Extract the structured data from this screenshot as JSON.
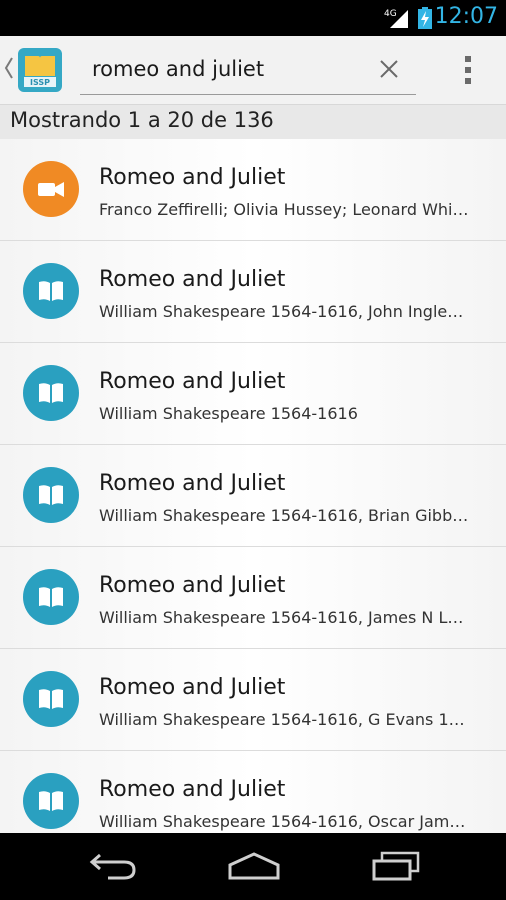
{
  "status_bar": {
    "time": "12:07",
    "network": "4G",
    "signal_icon": "signal-icon",
    "battery_icon": "battery-charging-icon",
    "accent": "#33b5e5"
  },
  "action_bar": {
    "back_icon": "back-caret-icon",
    "logo_icon": "app-logo-icon",
    "logo_text": "ISSP",
    "search": {
      "value": "romeo and juliet",
      "clear_icon": "close-icon"
    },
    "overflow_icon": "overflow-menu-icon"
  },
  "results_header": {
    "text": "Mostrando 1 a 20 de 136"
  },
  "colors": {
    "video": "#f08a24",
    "book": "#2aa0c0"
  },
  "results": [
    {
      "type": "video",
      "icon": "video-camera-icon",
      "title": "Romeo and Juliet",
      "subtitle": "Franco Zeffirelli; Olivia Hussey; Leonard Whi…"
    },
    {
      "type": "book",
      "icon": "book-icon",
      "title": "Romeo and Juliet",
      "subtitle": "William Shakespeare 1564-1616, John Ingle…"
    },
    {
      "type": "book",
      "icon": "book-icon",
      "title": "Romeo and Juliet",
      "subtitle": "William Shakespeare 1564-1616"
    },
    {
      "type": "book",
      "icon": "book-icon",
      "title": "Romeo and Juliet",
      "subtitle": "William Shakespeare 1564-1616, Brian Gibb…"
    },
    {
      "type": "book",
      "icon": "book-icon",
      "title": "Romeo and Juliet",
      "subtitle": "William Shakespeare 1564-1616, James N L…"
    },
    {
      "type": "book",
      "icon": "book-icon",
      "title": "Romeo and Juliet",
      "subtitle": "William Shakespeare 1564-1616, G Evans 1…"
    },
    {
      "type": "book",
      "icon": "book-icon",
      "title": "Romeo and Juliet",
      "subtitle": "William Shakespeare 1564-1616, Oscar Jam…"
    }
  ],
  "nav_bar": {
    "back_icon": "nav-back-icon",
    "home_icon": "nav-home-icon",
    "recents_icon": "nav-recents-icon"
  }
}
